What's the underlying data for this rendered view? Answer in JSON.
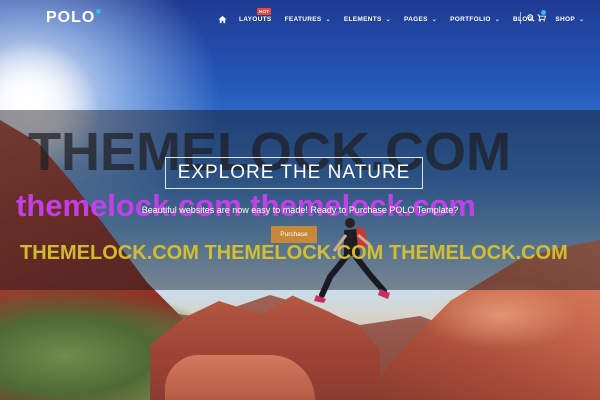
{
  "header": {
    "logo": "POLO",
    "nav": [
      {
        "label": "LAYOUTS",
        "badge": "HOT"
      },
      {
        "label": "FEATURES"
      },
      {
        "label": "ELEMENTS"
      },
      {
        "label": "PAGES"
      },
      {
        "label": "PORTFOLIO"
      },
      {
        "label": "BLOG"
      },
      {
        "label": "SHOP"
      }
    ]
  },
  "watermark": {
    "line1": "THEMELOCK.COM",
    "line2": "themelock.com themelock.com",
    "line3": "THEMELOCK.COM THEMELOCK.COM THEMELOCK.COM"
  },
  "hero": {
    "title": "EXPLORE THE NATURE",
    "subtitle": "Beautiful websites are now easy to made! Ready to Purchase POLO Template?",
    "button": "Purchase"
  },
  "colors": {
    "accent": "#3fb3f0",
    "hot_badge": "#e8483b",
    "button": "#c8883a"
  },
  "icons": [
    "home-icon",
    "chevron-down-icon",
    "search-icon",
    "cart-icon"
  ]
}
